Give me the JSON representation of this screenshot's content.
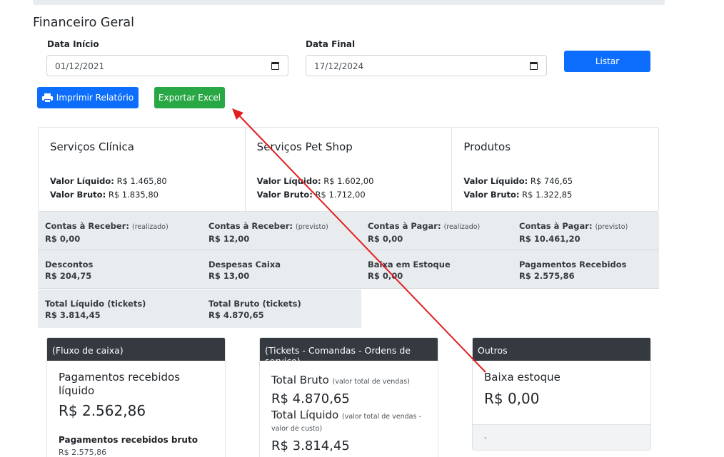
{
  "page": {
    "title": "Financeiro Geral"
  },
  "filters": {
    "start_label": "Data Início",
    "start_value": "01/12/2021",
    "end_label": "Data Final",
    "end_value": "17/12/2024",
    "list_button": "Listar"
  },
  "actions": {
    "print_button": "Imprimir Relatório",
    "excel_button": "Exportar Excel"
  },
  "summary": [
    {
      "title": "Serviços Clínica",
      "liquid_label": "Valor Líquido:",
      "liquid_value": "R$ 1.465,80",
      "gross_label": "Valor Bruto:",
      "gross_value": "R$ 1.835,80"
    },
    {
      "title": "Serviços Pet Shop",
      "liquid_label": "Valor Líquido:",
      "liquid_value": "R$ 1.602,00",
      "gross_label": "Valor Bruto:",
      "gross_value": "R$ 1.712,00"
    },
    {
      "title": "Produtos",
      "liquid_label": "Valor Líquido:",
      "liquid_value": "R$ 746,65",
      "gross_label": "Valor Bruto:",
      "gross_value": "R$ 1.322,85"
    }
  ],
  "stats": [
    {
      "label": "Contas à Receber:",
      "note": "(realizado)",
      "value": "R$ 0,00"
    },
    {
      "label": "Contas à Receber:",
      "note": "(previsto)",
      "value": "R$ 12,00"
    },
    {
      "label": "Contas à Pagar:",
      "note": "(realizado)",
      "value": "R$ 0,00"
    },
    {
      "label": "Contas à Pagar:",
      "note": "(previsto)",
      "value": "R$ 10.461,20"
    },
    {
      "label": "Descontos",
      "note": "",
      "value": "R$ 204,75"
    },
    {
      "label": "Despesas Caixa",
      "note": "",
      "value": "R$ 13,00"
    },
    {
      "label": "Baixa em Estoque",
      "note": "",
      "value": "R$ 0,00"
    },
    {
      "label": "Pagamentos Recebidos",
      "note": "",
      "value": "R$ 2.575,86"
    },
    {
      "label": "Total Líquido (tickets)",
      "note": "",
      "value": "R$ 3.814,45"
    },
    {
      "label": "Total Bruto (tickets)",
      "note": "",
      "value": "R$ 4.870,65"
    }
  ],
  "cards": {
    "cash": {
      "header": "(Fluxo de caixa)",
      "label1": "Pagamentos recebidos líquido",
      "value1": "R$ 2.562,86",
      "label2": "Pagamentos recebidos bruto",
      "value2": "R$ 2.575,86"
    },
    "tickets": {
      "header": "(Tickets - Comandas - Ordens de serviço)",
      "label1": "Total Bruto",
      "note1": "(valor total de vendas)",
      "value1": "R$ 4.870,65",
      "label2": "Total Líquido",
      "note2": "(valor total de vendas - valor de custo)",
      "value2": "R$ 3.814,45"
    },
    "others": {
      "header": "Outros",
      "label1": "Baixa estoque",
      "value1": "R$ 0,00",
      "footer": "-"
    }
  },
  "colors": {
    "primary": "#0d6efd",
    "success": "#28a745",
    "dark": "#343a40",
    "annotation": "#e02020"
  }
}
